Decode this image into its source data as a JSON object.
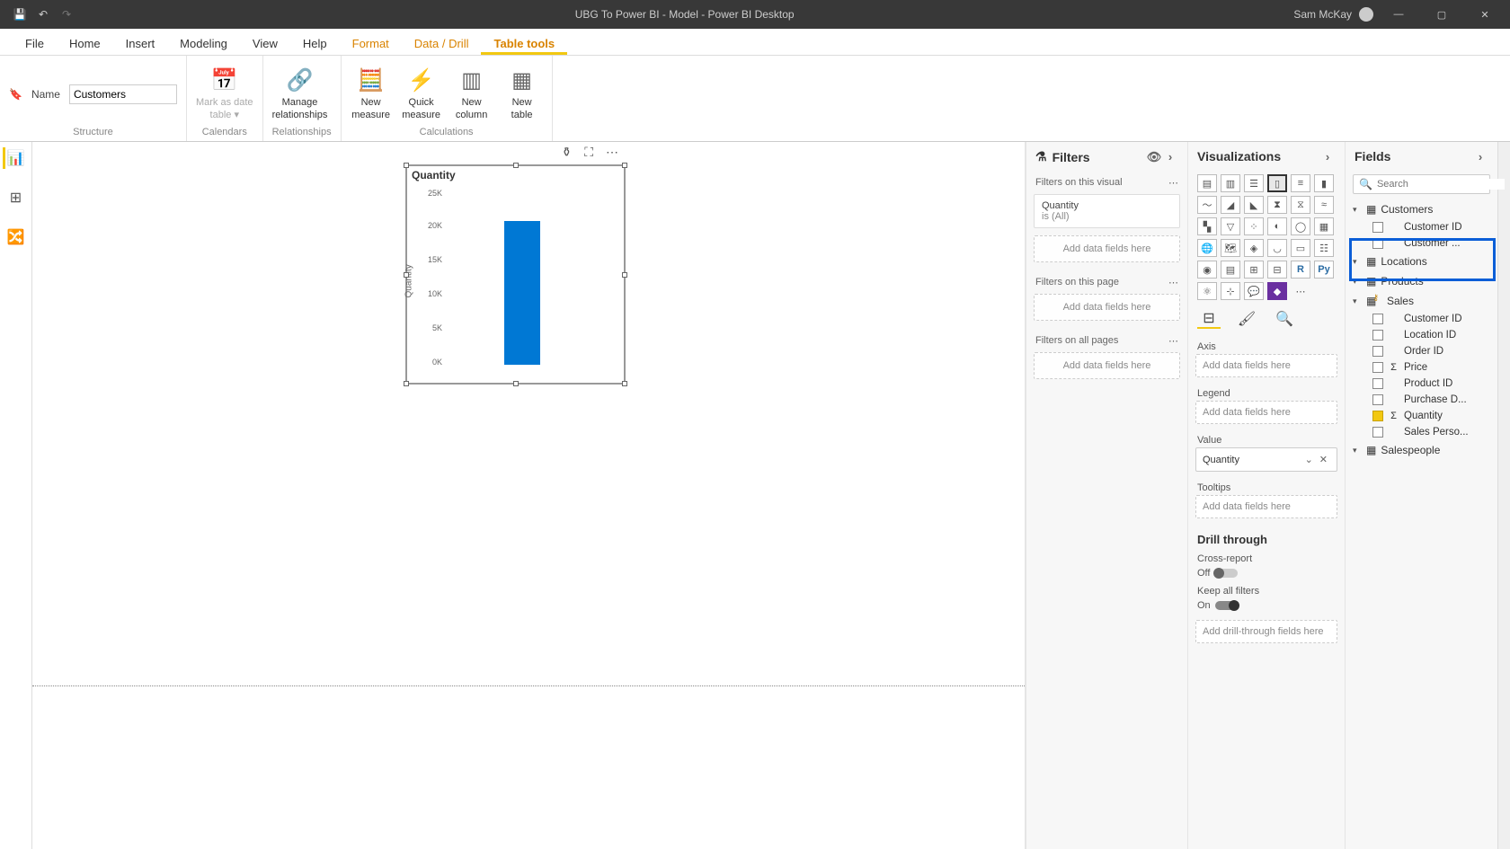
{
  "titlebar": {
    "title": "UBG To Power BI - Model - Power BI Desktop",
    "user": "Sam McKay"
  },
  "ribbonTabs": {
    "file": "File",
    "home": "Home",
    "insert": "Insert",
    "modeling": "Modeling",
    "view": "View",
    "help": "Help",
    "format": "Format",
    "datadrill": "Data / Drill",
    "tabletools": "Table tools"
  },
  "ribbon": {
    "nameLabel": "Name",
    "nameValue": "Customers",
    "structure": "Structure",
    "markDate1": "Mark as date",
    "markDate2": "table",
    "calendars": "Calendars",
    "manage1": "Manage",
    "manage2": "relationships",
    "relationships": "Relationships",
    "newMeasure1": "New",
    "newMeasure2": "measure",
    "quick1": "Quick",
    "quick2": "measure",
    "newCol1": "New",
    "newCol2": "column",
    "newTbl1": "New",
    "newTbl2": "table",
    "calculations": "Calculations"
  },
  "chart": {
    "title": "Quantity",
    "yaxis": "Quantity"
  },
  "chart_data": {
    "type": "bar",
    "title": "Quantity",
    "ylabel": "Quantity",
    "ylim": [
      0,
      25000
    ],
    "yticks": [
      "0K",
      "5K",
      "10K",
      "15K",
      "20K",
      "25K"
    ],
    "categories": [
      ""
    ],
    "values": [
      21000
    ]
  },
  "filters": {
    "header": "Filters",
    "onVisual": "Filters on this visual",
    "card1a": "Quantity",
    "card1b": "is (All)",
    "addData": "Add data fields here",
    "onPage": "Filters on this page",
    "onAll": "Filters on all pages"
  },
  "viz": {
    "header": "Visualizations",
    "axis": "Axis",
    "legend": "Legend",
    "value": "Value",
    "valueItem": "Quantity",
    "tooltips": "Tooltips",
    "addData": "Add data fields here",
    "drill": "Drill through",
    "crossReport": "Cross-report",
    "off": "Off",
    "keepAll": "Keep all filters",
    "on": "On",
    "addDrill": "Add drill-through fields here"
  },
  "fields": {
    "header": "Fields",
    "searchPlaceholder": "Search",
    "tables": {
      "customers": "Customers",
      "customersF1": "Customer ID",
      "customersF2": "Customer ...",
      "locations": "Locations",
      "products": "Products",
      "sales": "Sales",
      "salesFields": {
        "f1": "Customer ID",
        "f2": "Location ID",
        "f3": "Order ID",
        "f4": "Price",
        "f5": "Product ID",
        "f6": "Purchase D...",
        "f7": "Quantity",
        "f8": "Sales Perso..."
      },
      "salespeople": "Salespeople"
    }
  }
}
